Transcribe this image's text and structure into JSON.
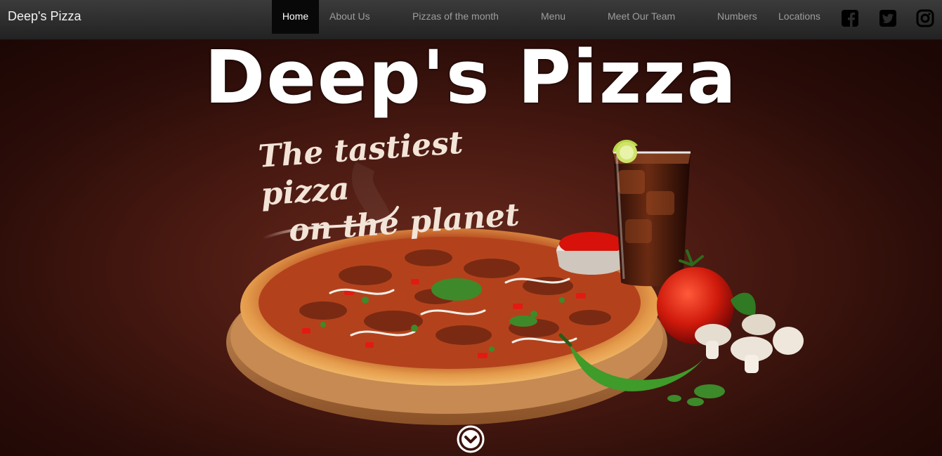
{
  "navbar": {
    "brand": "Deep's Pizza",
    "items": [
      {
        "label": "Home",
        "active": true
      },
      {
        "label": "About Us"
      },
      {
        "label": "Pizzas of the month"
      },
      {
        "label": "Menu"
      },
      {
        "label": "Meet Our Team"
      },
      {
        "label": "Numbers"
      },
      {
        "label": "Locations"
      }
    ],
    "social": [
      "facebook-icon",
      "twitter-icon",
      "instagram-icon"
    ]
  },
  "hero": {
    "title": "Deep's Pizza",
    "tagline_line1": "The tastiest pizza",
    "tagline_line2": "on the planet",
    "scroll_icon": "chevron-down-circle-icon"
  },
  "colors": {
    "navbar": "#2b2b2b",
    "nav_text": "#9d9d9d",
    "active_bg": "#080808",
    "hero_bg": "#4a1a12"
  }
}
